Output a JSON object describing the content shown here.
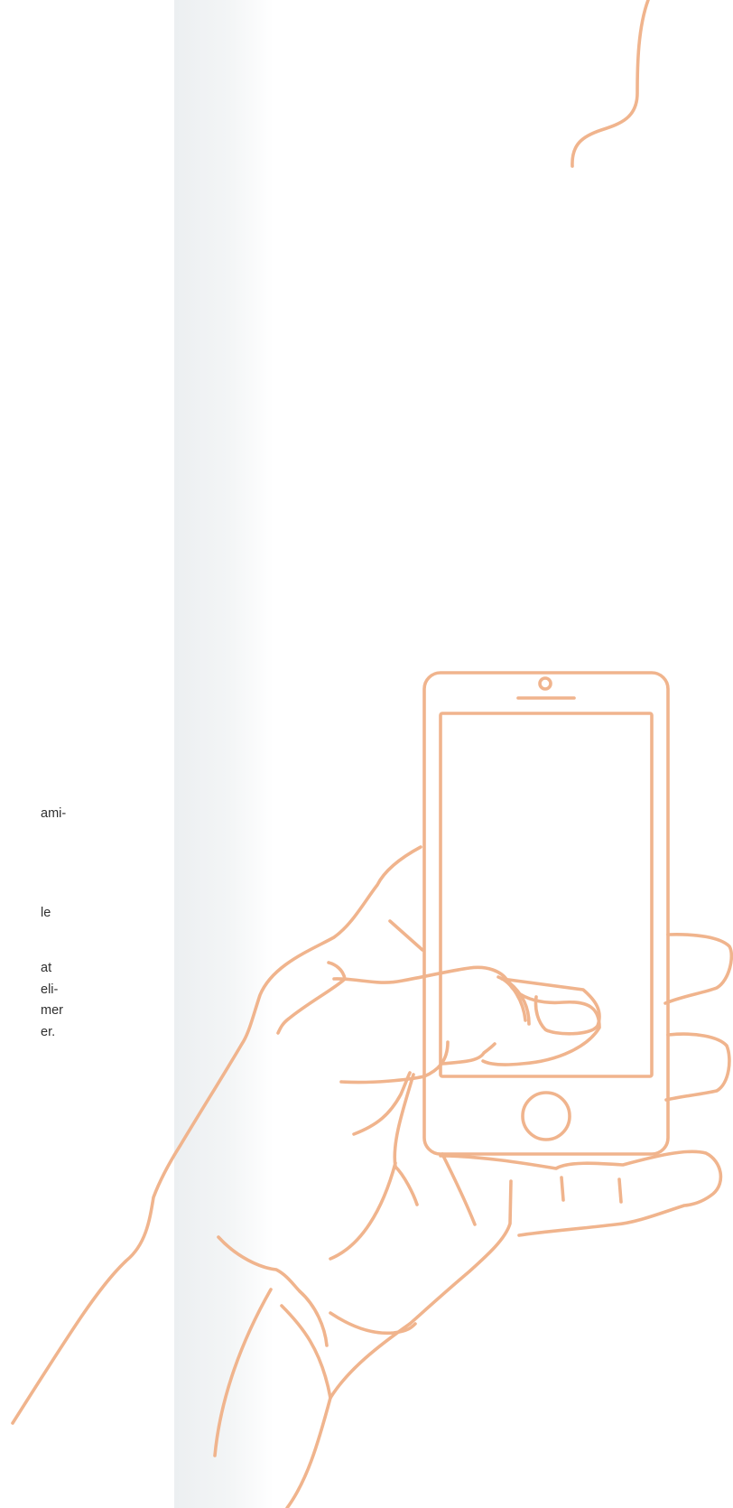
{
  "body_text_fragments": [
    "ami-",
    "le",
    "at",
    "eli-",
    "mer",
    "er."
  ],
  "colors": {
    "line_art": "#f0b48d",
    "left_band": "#eceff1",
    "text": "#2f2f2f",
    "background": "#ffffff"
  },
  "icons": {
    "illustration": "hand-holding-smartphone-icon",
    "decorative_curve": "wavy-line-icon"
  }
}
